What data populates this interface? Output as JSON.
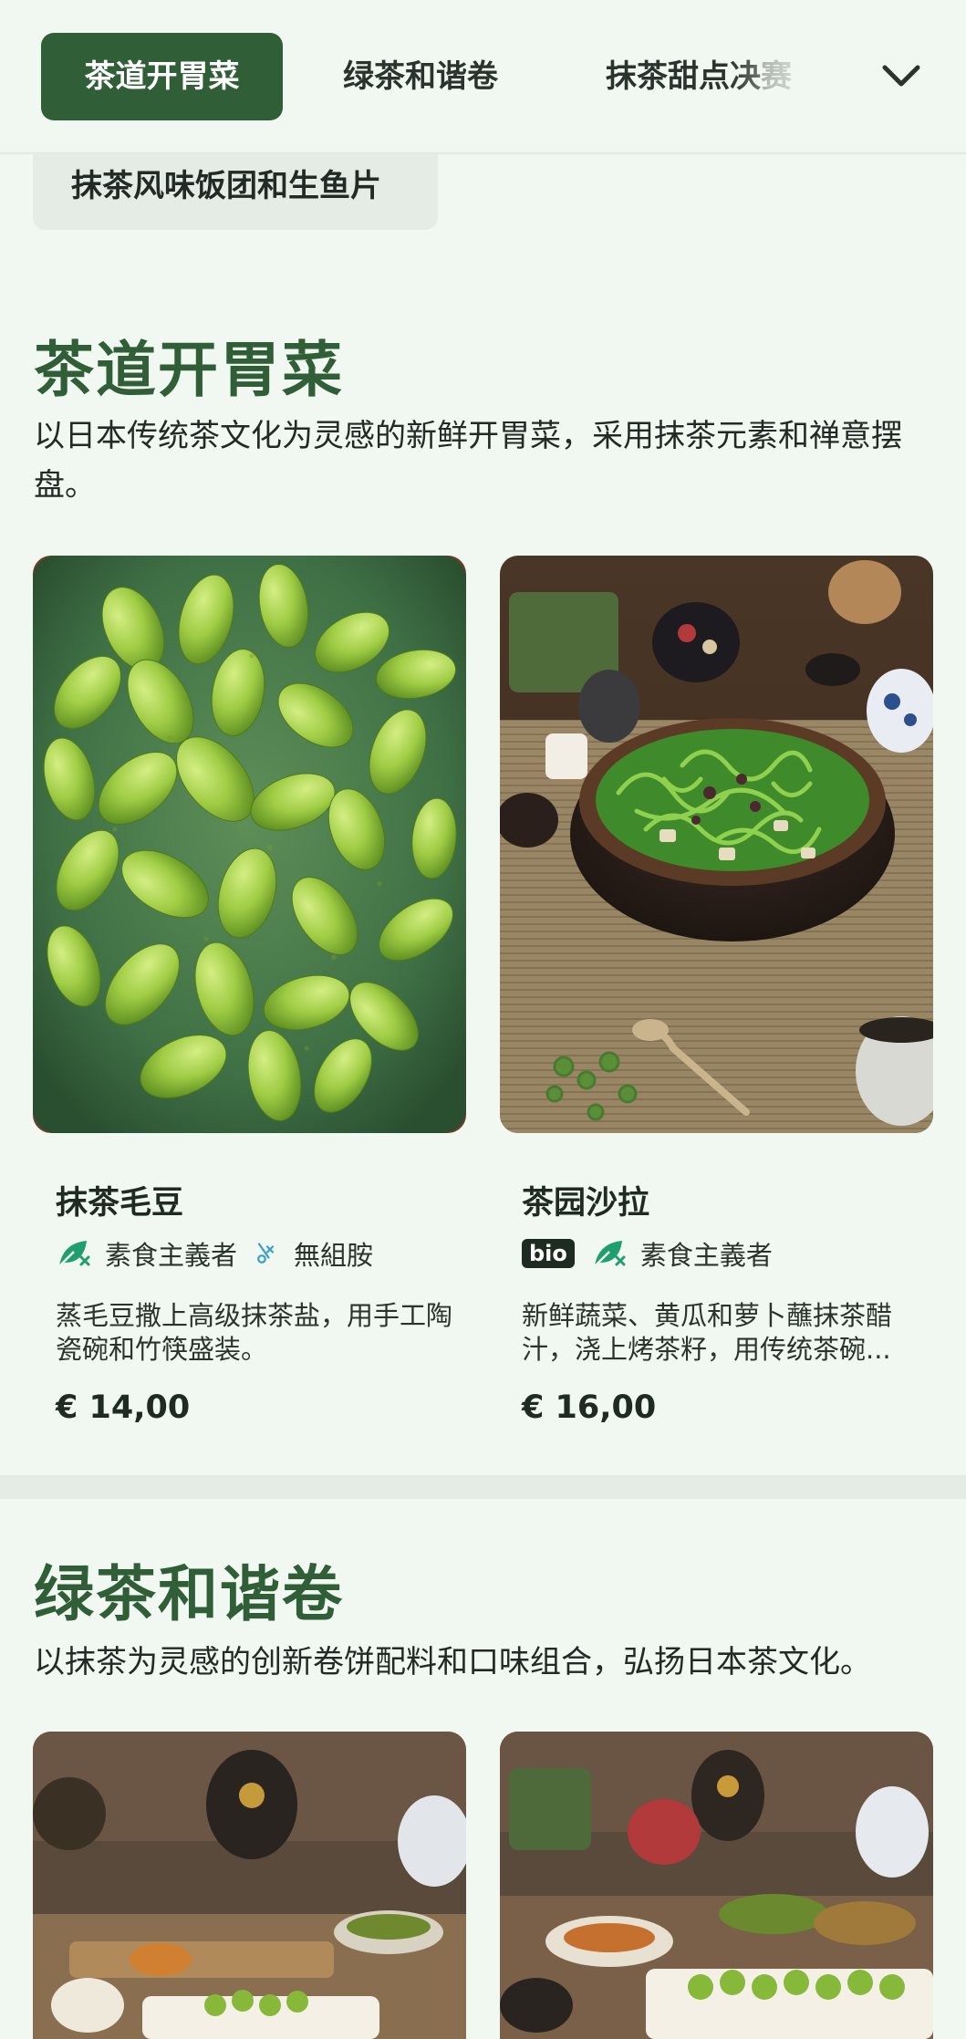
{
  "nav": {
    "tabs": [
      {
        "label": "茶道开胃菜",
        "active": true
      },
      {
        "label": "绿茶和谐卷",
        "active": false
      },
      {
        "label": "抹茶甜点决",
        "label_faded": "赛",
        "active": false
      }
    ],
    "expand_icon": "chevron-down-icon"
  },
  "subcategory": {
    "label": "抹茶风味饭团和生鱼片"
  },
  "sections": [
    {
      "title": "茶道开胃菜",
      "description": "以日本传统茶文化为灵感的新鲜开胃菜，采用抹茶元素和禅意摆盘。",
      "items": [
        {
          "name": "抹茶毛豆",
          "tags": [
            "素食主義者",
            "無組胺"
          ],
          "tag_icons": [
            "vegan-leaf-icon",
            "no-histamine-icon"
          ],
          "description": "蒸毛豆撒上高级抹茶盐，用手工陶瓷碗和竹筷盛装。",
          "price": "€ 14,00"
        },
        {
          "name": "茶园沙拉",
          "badge": "bio",
          "tags": [
            "素食主義者"
          ],
          "tag_icons": [
            "vegan-leaf-icon"
          ],
          "description": "新鲜蔬菜、黄瓜和萝卜蘸抹茶醋汁，浇上烤茶籽，用传统茶碗...",
          "price": "€ 16,00"
        }
      ]
    },
    {
      "title": "绿茶和谐卷",
      "description": "以抹茶为灵感的创新卷饼配料和口味组合，弘扬日本茶文化。"
    }
  ],
  "colors": {
    "accent": "#2f5e37",
    "background": "#f1f7f1",
    "tag_green": "#1f9e6e"
  }
}
